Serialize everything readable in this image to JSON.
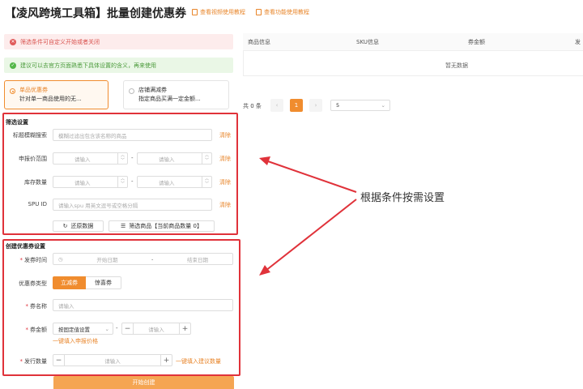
{
  "header": {
    "title": "【凌风跨境工具箱】批量创建优惠券",
    "link_video": "查看视频使用教程",
    "link_feature": "查看功能使用教程"
  },
  "alerts": {
    "error": "筛选条件可自定义开始或者关闭",
    "success": "建议可以去官方页面熟悉下具体设置的含义，再来使用"
  },
  "coupon_types": [
    {
      "title": "单品优惠券",
      "desc": "针对单一商品使用的无..."
    },
    {
      "title": "店铺满减券",
      "desc": "指定商品买满一定金额..."
    }
  ],
  "filter": {
    "section_title": "筛选设置",
    "title_search_label": "标题模糊搜索",
    "title_search_placeholder": "模糊过滤出包含该名称的商品",
    "price_label": "申报价范围",
    "stock_label": "库存数量",
    "spu_label": "SPU ID",
    "spu_placeholder": "请输入spu 用英文逗号或空格分隔",
    "number_placeholder": "请输入",
    "range_sep": "-",
    "clear_label": "清除",
    "reset_label": "还原数据",
    "filter_button_label": "筛选商品【当前商品数量 0】"
  },
  "create": {
    "section_title": "创建优惠券设置",
    "time_label": "发券时间",
    "start_placeholder": "开始日期",
    "end_placeholder": "结束日期",
    "type_label": "优惠券类型",
    "type_options": [
      "立减券",
      "惊喜券"
    ],
    "name_label": "券名称",
    "name_placeholder": "请输入",
    "amount_label": "券金额",
    "amount_mode": "按固定值设置",
    "amount_placeholder": "请输入",
    "amount_quick": "一键填入申报价格",
    "qty_label": "发行数量",
    "qty_placeholder": "请输入",
    "qty_quick": "一键填入建议数量",
    "submit_label": "开始创建"
  },
  "table": {
    "columns": [
      "商品信息",
      "SKU信息",
      "券金额",
      "发"
    ],
    "empty_text": "暂无数据"
  },
  "pagination": {
    "total": "共 0 条",
    "current_page": "1",
    "page_size": "5"
  },
  "annotation": "根据条件按需设置",
  "colors": {
    "accent": "#f08c2e",
    "annotation_red": "#e0323a"
  }
}
